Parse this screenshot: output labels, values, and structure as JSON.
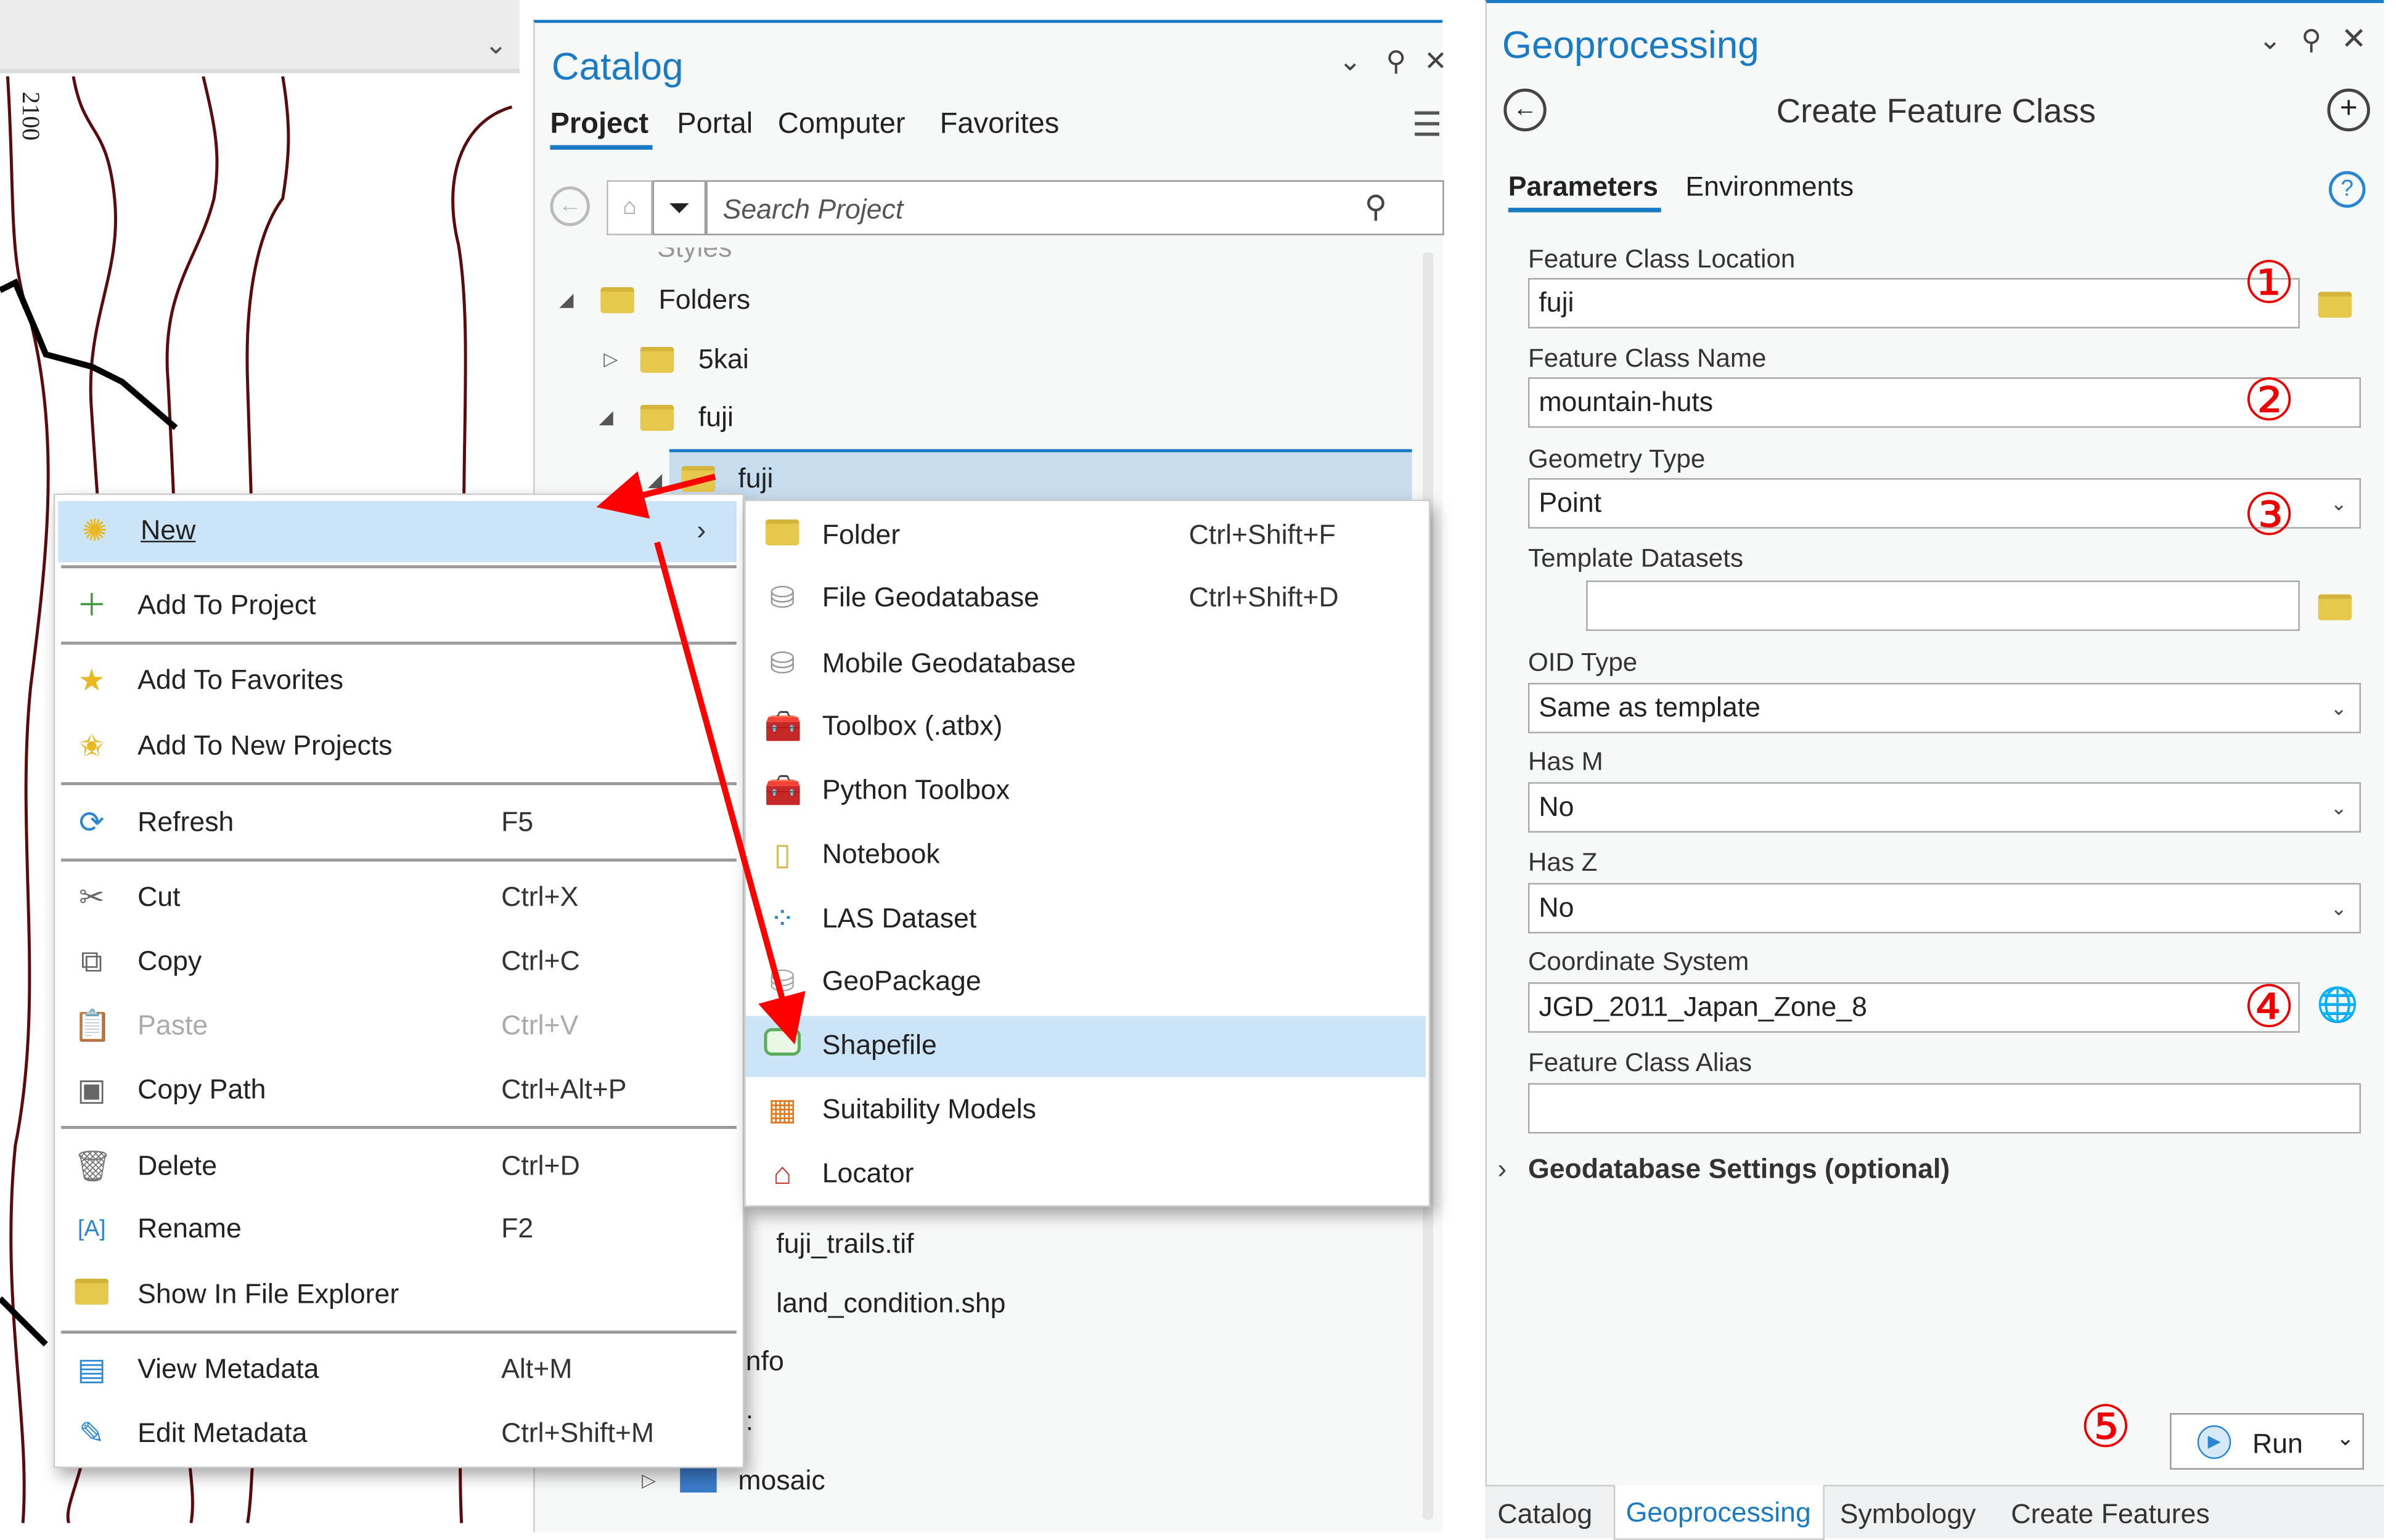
{
  "map": {
    "contour_label": "2100"
  },
  "catalog": {
    "title": "Catalog",
    "tabs": [
      "Project",
      "Portal",
      "Computer",
      "Favorites"
    ],
    "search_placeholder": "Search Project",
    "tree": [
      {
        "label": "Styles"
      },
      {
        "label": "Folders"
      },
      {
        "label": "5kai"
      },
      {
        "label": "fuji"
      },
      {
        "label": "fuji",
        "selected": true
      },
      {
        "label": "fuji_trails.tif"
      },
      {
        "label": "land_condition.shp"
      },
      {
        "label": "nfo"
      },
      {
        "label": ":"
      },
      {
        "label": "mosaic"
      }
    ]
  },
  "context_menu": {
    "items": [
      {
        "label": "New",
        "icon": "sparkle-icon",
        "shortcut": ""
      },
      {
        "label": "Add To Project",
        "icon": "plus-icon",
        "shortcut": ""
      },
      {
        "label": "Add To Favorites",
        "icon": "star-icon",
        "shortcut": ""
      },
      {
        "label": "Add To New Projects",
        "icon": "star-add-icon",
        "shortcut": ""
      },
      {
        "label": "Refresh",
        "icon": "refresh-icon",
        "shortcut": "F5"
      },
      {
        "label": "Cut",
        "icon": "scissors-icon",
        "shortcut": "Ctrl+X"
      },
      {
        "label": "Copy",
        "icon": "copy-icon",
        "shortcut": "Ctrl+C"
      },
      {
        "label": "Paste",
        "icon": "paste-icon",
        "shortcut": "Ctrl+V",
        "disabled": true
      },
      {
        "label": "Copy Path",
        "icon": "copy-path-icon",
        "shortcut": "Ctrl+Alt+P"
      },
      {
        "label": "Delete",
        "icon": "trash-icon",
        "shortcut": "Ctrl+D"
      },
      {
        "label": "Rename",
        "icon": "rename-icon",
        "shortcut": "F2"
      },
      {
        "label": "Show In File Explorer",
        "icon": "folder-open-icon",
        "shortcut": ""
      },
      {
        "label": "View Metadata",
        "icon": "document-icon",
        "shortcut": "Alt+M"
      },
      {
        "label": "Edit Metadata",
        "icon": "pencil-icon",
        "shortcut": "Ctrl+Shift+M"
      }
    ]
  },
  "submenu": {
    "items": [
      {
        "label": "Folder",
        "shortcut": "Ctrl+Shift+F"
      },
      {
        "label": "File Geodatabase",
        "shortcut": "Ctrl+Shift+D"
      },
      {
        "label": "Mobile Geodatabase",
        "shortcut": ""
      },
      {
        "label": "Toolbox (.atbx)",
        "shortcut": ""
      },
      {
        "label": "Python Toolbox",
        "shortcut": ""
      },
      {
        "label": "Notebook",
        "shortcut": ""
      },
      {
        "label": "LAS Dataset",
        "shortcut": ""
      },
      {
        "label": "GeoPackage",
        "shortcut": ""
      },
      {
        "label": "Shapefile",
        "shortcut": "",
        "highlighted": true
      },
      {
        "label": "Suitability Models",
        "shortcut": ""
      },
      {
        "label": "Locator",
        "shortcut": ""
      }
    ]
  },
  "geoprocessing": {
    "title": "Geoprocessing",
    "tool_title": "Create Feature Class",
    "tabs": [
      "Parameters",
      "Environments"
    ],
    "params": {
      "location": {
        "label": "Feature Class Location",
        "value": "fuji"
      },
      "name": {
        "label": "Feature Class Name",
        "value": "mountain-huts"
      },
      "geometry": {
        "label": "Geometry Type",
        "value": "Point"
      },
      "template": {
        "label": "Template Datasets",
        "value": ""
      },
      "oid": {
        "label": "OID Type",
        "value": "Same as template"
      },
      "has_m": {
        "label": "Has M",
        "value": "No"
      },
      "has_z": {
        "label": "Has Z",
        "value": "No"
      },
      "coord": {
        "label": "Coordinate System",
        "value": "JGD_2011_Japan_Zone_8"
      },
      "alias": {
        "label": "Feature Class Alias",
        "value": ""
      }
    },
    "gdb_settings": "Geodatabase Settings (optional)",
    "run": "Run",
    "bottom_tabs": [
      "Catalog",
      "Geoprocessing",
      "Symbology",
      "Create Features"
    ]
  },
  "annotations": [
    "①",
    "②",
    "③",
    "④",
    "⑤"
  ],
  "colors": {
    "accent": "#1a7ac4",
    "highlight": "#cce4f7",
    "annotation": "#ee0000"
  }
}
